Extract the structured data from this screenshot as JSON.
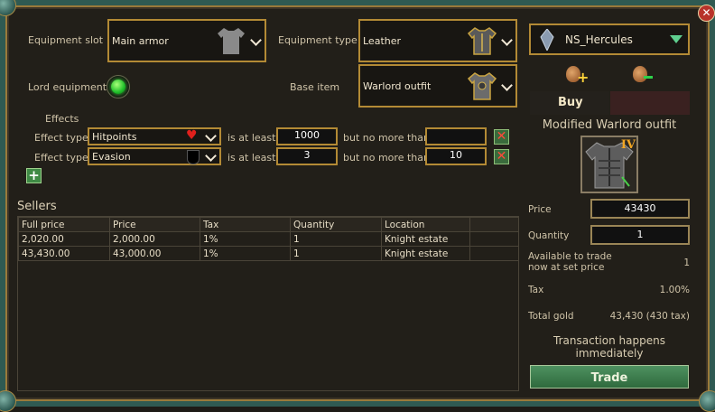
{
  "filters": {
    "equipment_slot_label": "Equipment slot",
    "equipment_slot_value": "Main armor",
    "equipment_type_label": "Equipment type",
    "equipment_type_value": "Leather",
    "lord_equipment_label": "Lord equipment",
    "base_item_label": "Base item",
    "base_item_value": "Warlord outfit"
  },
  "effects": {
    "title": "Effects",
    "rows": [
      {
        "type_label": "Effect type",
        "value": "Hitpoints",
        "at_least_label": "is at least",
        "min": "1000",
        "no_more_label": "but no more than",
        "max": ""
      },
      {
        "type_label": "Effect type",
        "value": "Evasion",
        "at_least_label": "is at least",
        "min": "3",
        "no_more_label": "but no more than",
        "max": "10"
      }
    ]
  },
  "sellers": {
    "title": "Sellers",
    "columns": [
      "Full price",
      "Price",
      "Tax",
      "Quantity",
      "Location"
    ],
    "rows": [
      [
        "2,020.00",
        "2,000.00",
        "1%",
        "1",
        "Knight estate"
      ],
      [
        "43,430.00",
        "43,000.00",
        "1%",
        "1",
        "Knight estate"
      ]
    ]
  },
  "right": {
    "character": "NS_Hercules",
    "buy_label": "Buy",
    "item_title": "Modified Warlord outfit",
    "item_tier": "IV",
    "price_label": "Price",
    "price_value": "43430",
    "quantity_label": "Quantity",
    "quantity_value": "1",
    "available_label_1": "Available to trade",
    "available_label_2": "now at set price",
    "available_value": "1",
    "tax_label": "Tax",
    "tax_value": "1.00%",
    "total_label": "Total gold",
    "total_value": "43,430 (430 tax)",
    "transaction_note_1": "Transaction happens",
    "transaction_note_2": "immediately",
    "trade_label": "Trade"
  },
  "colors": {
    "accent_gold": "#b38a35",
    "trade_green": "#3f7a4e",
    "frame_teal": "#2f5a52"
  },
  "toggles": {
    "lord_equipment_on": true
  }
}
